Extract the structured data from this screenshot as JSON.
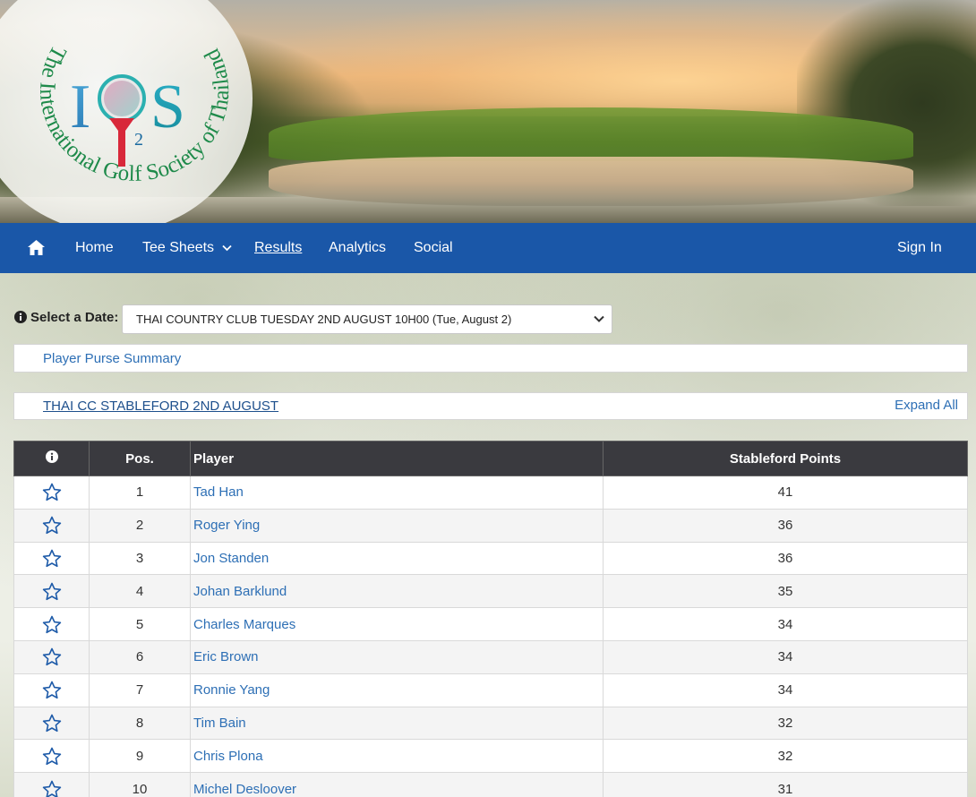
{
  "logo": {
    "ring_text": "The International Golf Society of Thailand",
    "letters": [
      "I",
      "G",
      "S"
    ],
    "superscript": "2"
  },
  "nav": {
    "home_icon": "home-icon",
    "items": [
      {
        "label": "Home"
      },
      {
        "label": "Tee Sheets"
      },
      {
        "label": "Results"
      },
      {
        "label": "Analytics"
      },
      {
        "label": "Social"
      }
    ],
    "sign_in": "Sign In",
    "bg_color": "#1a57a8"
  },
  "date_picker": {
    "label": "Select a Date:",
    "selected": "THAI COUNTRY CLUB TUESDAY 2ND AUGUST 10H00 (Tue, August 2)"
  },
  "purse_summary": {
    "label": "Player Purse Summary"
  },
  "competition": {
    "title": "THAI CC STABLEFORD 2ND AUGUST",
    "expand_all": "Expand All"
  },
  "table": {
    "headers": {
      "pos": "Pos.",
      "player": "Player",
      "points": "Stableford Points"
    },
    "rows": [
      {
        "pos": "1",
        "player": "Tad Han",
        "points": "41"
      },
      {
        "pos": "2",
        "player": "Roger Ying",
        "points": "36"
      },
      {
        "pos": "3",
        "player": "Jon Standen",
        "points": "36"
      },
      {
        "pos": "4",
        "player": "Johan Barklund",
        "points": "35"
      },
      {
        "pos": "5",
        "player": "Charles Marques",
        "points": "34"
      },
      {
        "pos": "6",
        "player": "Eric Brown",
        "points": "34"
      },
      {
        "pos": "7",
        "player": "Ronnie Yang",
        "points": "34"
      },
      {
        "pos": "8",
        "player": "Tim Bain",
        "points": "32"
      },
      {
        "pos": "9",
        "player": "Chris Plona",
        "points": "32"
      },
      {
        "pos": "10",
        "player": "Michel Desloover",
        "points": "31"
      }
    ]
  }
}
